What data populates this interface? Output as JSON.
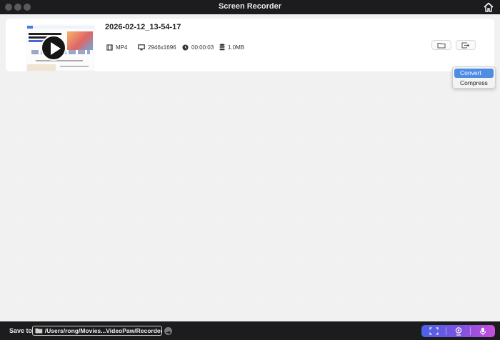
{
  "window": {
    "title": "Screen Recorder"
  },
  "recording": {
    "filename": "2026-02-12_13-54-17",
    "format": "MP4",
    "resolution": "2946x1696",
    "duration": "00:00:03",
    "size": "1.0MB"
  },
  "menu": {
    "items": [
      "Convert",
      "Compress"
    ]
  },
  "footer": {
    "save_label": "Save to",
    "save_path": "/Users/rong/Movies...VideoPaw/Recorded"
  },
  "colors": {
    "accent": "#4f8de4",
    "titlebar": "#1c1c1e",
    "record_gradient_start": "#4b63e8",
    "record_gradient_end": "#c84fdc"
  }
}
